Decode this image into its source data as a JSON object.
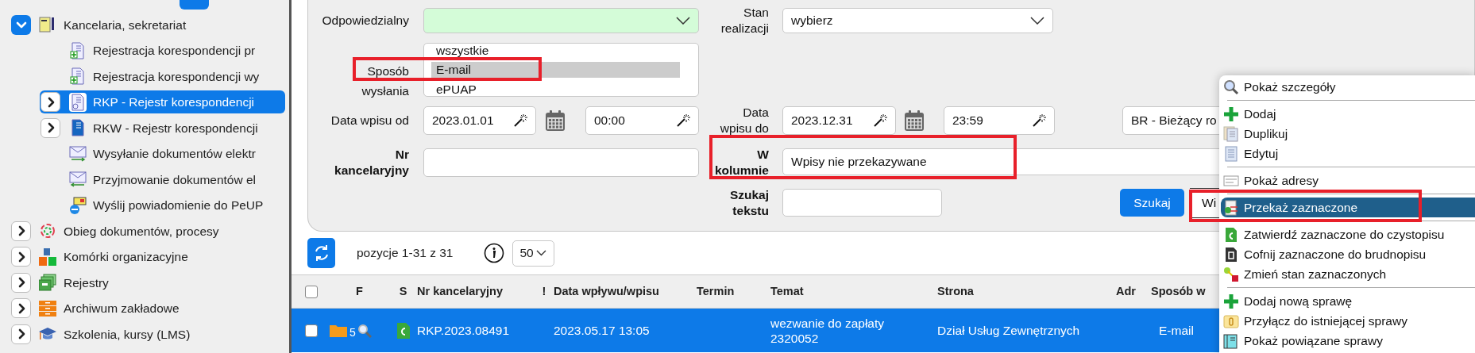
{
  "sidebar": {
    "items": [
      {
        "label": "Kancelaria, sekretariat",
        "expanded": true,
        "selected": false,
        "children": [
          {
            "label": "Rejestracja korespondencji pr",
            "selected": false
          },
          {
            "label": "Rejestracja korespondencji wy",
            "selected": false
          },
          {
            "label": "RKP - Rejestr korespondencji",
            "selected": true,
            "expanded": false
          },
          {
            "label": "RKW - Rejestr korespondencji",
            "selected": false,
            "expanded": false
          },
          {
            "label": "Wysyłanie dokumentów elektr",
            "selected": false
          },
          {
            "label": "Przyjmowanie dokumentów el",
            "selected": false
          },
          {
            "label": "Wyślij powiadomienie do PeUP",
            "selected": false
          }
        ]
      },
      {
        "label": "Obieg dokumentów, procesy",
        "expanded": false,
        "selected": false
      },
      {
        "label": "Komórki organizacyjne",
        "expanded": false,
        "selected": false
      },
      {
        "label": "Rejestry",
        "expanded": false,
        "selected": false
      },
      {
        "label": "Archiwum zakładowe",
        "expanded": false,
        "selected": false
      },
      {
        "label": "Szkolenia, kursy (LMS)",
        "expanded": false,
        "selected": false
      }
    ]
  },
  "filter_form": {
    "responsible": {
      "label": "Odpowiedzialny"
    },
    "status": {
      "label": "Stan realizacji",
      "value": "wybierz"
    },
    "send_method": {
      "label": "Sposób wysłania",
      "highlighted": true,
      "options": [
        {
          "label": "wszystkie",
          "selected": false
        },
        {
          "label": "E-mail",
          "selected": true
        },
        {
          "label": "ePUAP",
          "selected": false
        }
      ]
    },
    "date_from": {
      "label": "Data wpisu od",
      "date": "2023.01.01",
      "time": "00:00"
    },
    "date_to": {
      "label": "Data wpisu do",
      "date": "2023.12.31",
      "time": "23:59"
    },
    "period": {
      "value": "BR - Bieżący ro"
    },
    "office_number": {
      "label": "Nr kancelaryjny"
    },
    "in_column": {
      "label": "W kolumnie",
      "value": "Wpisy nie przekazywane",
      "highlighted": true
    },
    "search_text": {
      "label": "Szukaj tekstu"
    },
    "buttons": [
      "Szukaj",
      "Wi"
    ]
  },
  "toolbar": {
    "range": "pozycje 1-31 z 31",
    "page_size": "50"
  },
  "table": {
    "select_all_checked": false,
    "columns": [
      "F",
      "S",
      "Nr kancelaryjny",
      "!",
      "Data wpływu/wpisu",
      "Termin",
      "Temat",
      "Strona",
      "Adr",
      "Sposób w"
    ],
    "rows": [
      {
        "selected": true,
        "checked": false,
        "folder_count": "5",
        "number": "RKP.2023.08491",
        "date": "2023.05.17 13:05",
        "topic": "wezwanie do zapłaty 2320052",
        "party": "Dział Usług Zewnętrznych",
        "method": "E-mail"
      }
    ]
  },
  "context_menu": {
    "highlighted": true,
    "groups": [
      {
        "items": [
          {
            "label": "Pokaż szczegóły",
            "selected": false
          }
        ]
      },
      {
        "items": [
          {
            "label": "Dodaj",
            "selected": false
          },
          {
            "label": "Duplikuj",
            "selected": false
          },
          {
            "label": "Edytuj",
            "selected": false
          }
        ]
      },
      {
        "items": [
          {
            "label": "Pokaż adresy",
            "selected": false
          }
        ]
      },
      {
        "items": [
          {
            "label": "Przekaż zaznaczone",
            "selected": true
          }
        ]
      },
      {
        "items": [
          {
            "label": "Zatwierdź zaznaczone do czystopisu",
            "selected": false
          },
          {
            "label": "Cofnij zaznaczone do brudnopisu",
            "selected": false
          },
          {
            "label": "Zmień stan zaznaczonych",
            "selected": false
          }
        ]
      },
      {
        "items": [
          {
            "label": "Dodaj nową sprawę",
            "selected": false
          },
          {
            "label": "Przyłącz do istniejącej sprawy",
            "selected": false
          },
          {
            "label": "Pokaż powiązane sprawy",
            "selected": false
          }
        ]
      }
    ]
  }
}
